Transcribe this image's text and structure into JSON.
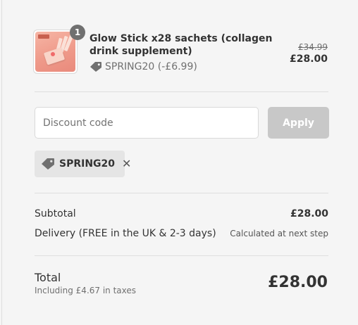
{
  "cart": {
    "items": [
      {
        "quantity": "1",
        "title": "Glow Stick x28 sachets (collagen drink supplement)",
        "discount": "SPRING20 (-£6.99)",
        "original_price": "£34.99",
        "price": "£28.00"
      }
    ]
  },
  "discount": {
    "placeholder": "Discount code",
    "apply_label": "Apply",
    "applied_code": "SPRING20"
  },
  "summary": {
    "subtotal_label": "Subtotal",
    "subtotal_value": "£28.00",
    "delivery_label": "Delivery (FREE in the UK & 2-3 days)",
    "delivery_value": "Calculated at next step",
    "total_label": "Total",
    "tax_note": "Including £4.67 in taxes",
    "total_value": "£28.00"
  }
}
